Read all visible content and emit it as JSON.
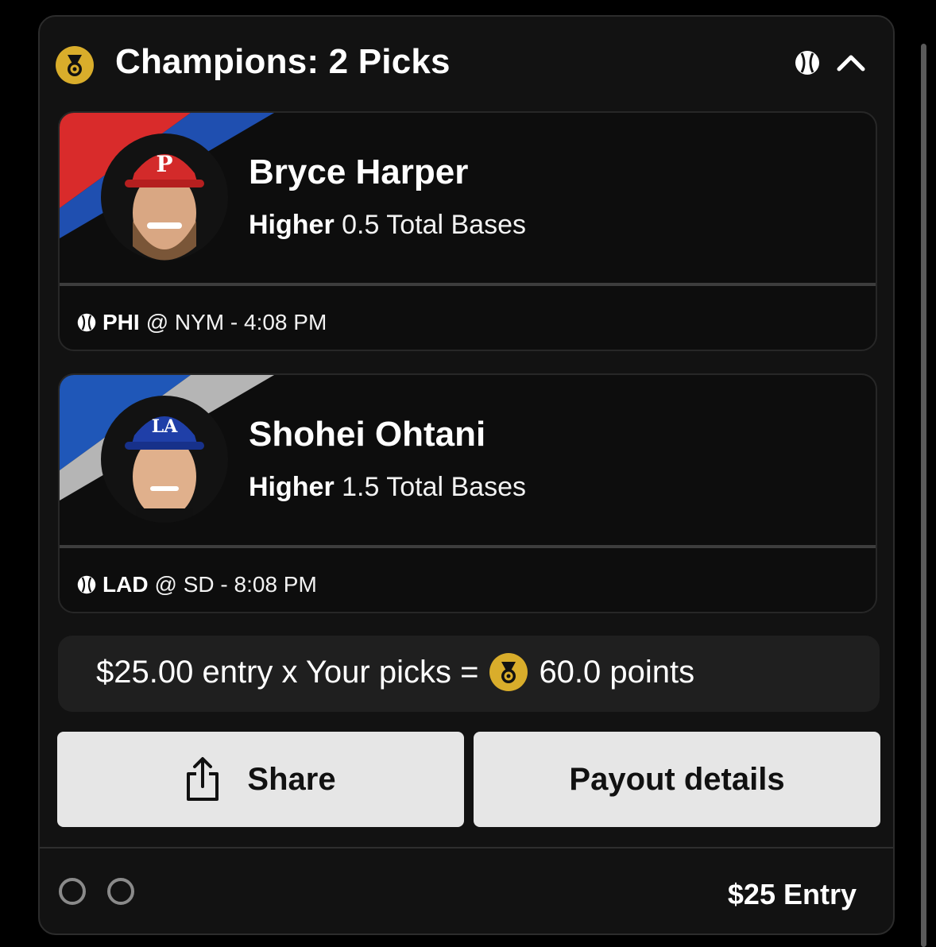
{
  "header": {
    "title": "Champions: 2 Picks",
    "medal_icon": "medal-icon",
    "sport_icon": "baseball-icon",
    "collapse_icon": "chevron-up-icon"
  },
  "picks": [
    {
      "player": "Bryce Harper",
      "direction": "Higher",
      "projection": "0.5 Total Bases",
      "team": "PHI",
      "matchup_rest": "@ NYM - 4:08 PM",
      "stripe_colors": [
        "#d92b2b",
        "#1f4fb0"
      ]
    },
    {
      "player": "Shohei Ohtani",
      "direction": "Higher",
      "projection": "1.5 Total Bases",
      "team": "LAD",
      "matchup_rest": "@ SD - 8:08 PM",
      "stripe_colors": [
        "#1f57b8",
        "#b5b5b5"
      ]
    }
  ],
  "summary": {
    "prefix": "$25.00 entry x Your picks =",
    "points": "60.0 points"
  },
  "buttons": {
    "share": "Share",
    "payout": "Payout details"
  },
  "footer": {
    "entry": "$25 Entry"
  },
  "colors": {
    "gold": "#d9ad2b",
    "card_bg": "#121212",
    "button_bg": "#e6e6e6"
  }
}
